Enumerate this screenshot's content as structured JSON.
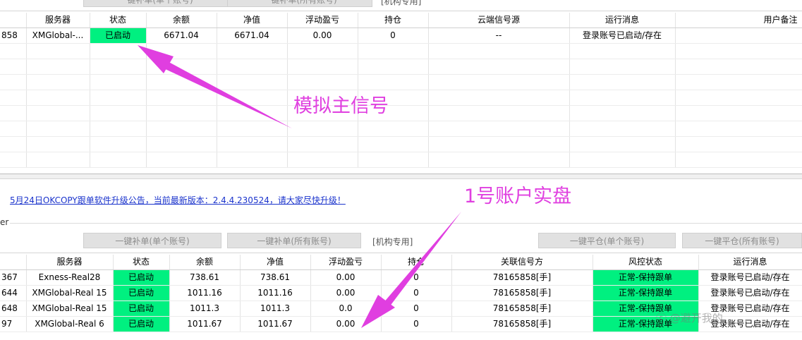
{
  "top_toolbar": {
    "btn1": "一键补单(单个账号)",
    "btn2": "一键补单(所有账号)",
    "note": "[机构专用]"
  },
  "top_table": {
    "headers": [
      "服务器",
      "状态",
      "余额",
      "净值",
      "浮动盈亏",
      "持仓",
      "云端信号源",
      "运行消息",
      "用户备注"
    ],
    "row": {
      "id": "858",
      "server": "XMGlobal-...",
      "status": "已启动",
      "balance": "6671.04",
      "equity": "6671.04",
      "pnl": "0.00",
      "position": "0",
      "signal": "--",
      "message": "登录账号已启动/存在"
    }
  },
  "announcement": "5月24日OKCOPY跟单软件升级公告，当前最新版本：2.4.4.230524，请大家尽快升级！",
  "partial_label": "er",
  "bottom_toolbar": {
    "btn1": "一键补单(单个账号)",
    "btn2": "一键补单(所有账号)",
    "note": "[机构专用]",
    "btn3": "一键平仓(单个账号)",
    "btn4": "一键平仓(所有账号)"
  },
  "bottom_table": {
    "headers": [
      "服务器",
      "状态",
      "余额",
      "净值",
      "浮动盈亏",
      "持仓",
      "关联信号方",
      "风控状态",
      "运行消息"
    ],
    "rows": [
      {
        "id": "367",
        "server": "Exness-Real28",
        "status": "已启动",
        "balance": "738.61",
        "equity": "738.61",
        "pnl": "0.00",
        "position": "0",
        "signal": "78165858[手]",
        "risk": "正常-保持跟单",
        "message": "登录账号已启动/存在"
      },
      {
        "id": "644",
        "server": "XMGlobal-Real 15",
        "status": "已启动",
        "balance": "1011.16",
        "equity": "1011.16",
        "pnl": "0.00",
        "position": "0",
        "signal": "78165858[手]",
        "risk": "正常-保持跟单",
        "message": "登录账号已启动/存在"
      },
      {
        "id": "648",
        "server": "XMGlobal-Real 15",
        "status": "已启动",
        "balance": "1011.3",
        "equity": "1011.3",
        "pnl": "0.0",
        "position": "0",
        "signal": "78165858[手]",
        "risk": "正常-保持跟单",
        "message": "登录账号已启动/存在"
      },
      {
        "id": "97",
        "server": "XMGlobal-Real 6",
        "status": "已启动",
        "balance": "1011.67",
        "equity": "1011.67",
        "pnl": "0.00",
        "position": "0",
        "signal": "78165858[手]",
        "risk": "正常-保持跟单",
        "message": "登录账号已启动/存在"
      }
    ]
  },
  "annotations": {
    "sim_signal": "模拟主信号",
    "account_real": "1号账户实盘"
  },
  "watermark": "@避开我的"
}
